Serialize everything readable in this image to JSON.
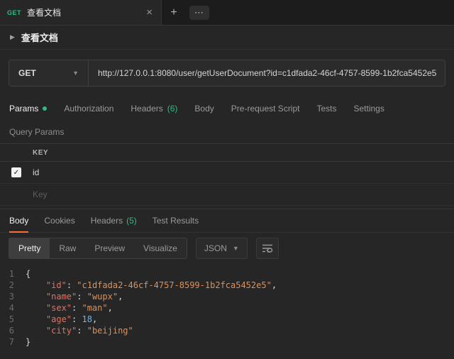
{
  "icons": {
    "close": "×",
    "plus": "+",
    "more": "⋯",
    "chevron_right": "▶",
    "chevron_down": "▼",
    "check": "✓"
  },
  "tab_bar": {
    "tab": {
      "method": "GET",
      "title": "查看文档"
    }
  },
  "request_header": {
    "title": "查看文档"
  },
  "url_bar": {
    "method": "GET",
    "url": "http://127.0.0.1:8080/user/getUserDocument?id=c1dfada2-46cf-4757-8599-1b2fca5452e5"
  },
  "request_tabs": [
    {
      "label": "Params"
    },
    {
      "label": "Authorization"
    },
    {
      "label": "Headers",
      "count": "(6)"
    },
    {
      "label": "Body"
    },
    {
      "label": "Pre-request Script"
    },
    {
      "label": "Tests"
    },
    {
      "label": "Settings"
    }
  ],
  "query_params": {
    "section_label": "Query Params",
    "key_header": "KEY",
    "rows": [
      {
        "key": "id",
        "checked": true
      },
      {
        "key_placeholder": "Key"
      }
    ]
  },
  "response": {
    "tabs": [
      {
        "label": "Body"
      },
      {
        "label": "Cookies"
      },
      {
        "label": "Headers",
        "count": "(5)"
      },
      {
        "label": "Test Results"
      }
    ],
    "modes": [
      "Pretty",
      "Raw",
      "Preview",
      "Visualize"
    ],
    "language": "JSON",
    "code": {
      "lines": [
        {
          "num": "1",
          "tokens": [
            {
              "type": "punc",
              "text": "{"
            }
          ]
        },
        {
          "num": "2",
          "tokens": [
            {
              "type": "punc",
              "text": "    "
            },
            {
              "type": "key",
              "text": "\"id\""
            },
            {
              "type": "punc",
              "text": ": "
            },
            {
              "type": "string",
              "text": "\"c1dfada2-46cf-4757-8599-1b2fca5452e5\""
            },
            {
              "type": "punc",
              "text": ","
            }
          ]
        },
        {
          "num": "3",
          "tokens": [
            {
              "type": "punc",
              "text": "    "
            },
            {
              "type": "key",
              "text": "\"name\""
            },
            {
              "type": "punc",
              "text": ": "
            },
            {
              "type": "string",
              "text": "\"wupx\""
            },
            {
              "type": "punc",
              "text": ","
            }
          ]
        },
        {
          "num": "4",
          "tokens": [
            {
              "type": "punc",
              "text": "    "
            },
            {
              "type": "key",
              "text": "\"sex\""
            },
            {
              "type": "punc",
              "text": ": "
            },
            {
              "type": "string",
              "text": "\"man\""
            },
            {
              "type": "punc",
              "text": ","
            }
          ]
        },
        {
          "num": "5",
          "tokens": [
            {
              "type": "punc",
              "text": "    "
            },
            {
              "type": "key",
              "text": "\"age\""
            },
            {
              "type": "punc",
              "text": ": "
            },
            {
              "type": "number",
              "text": "18"
            },
            {
              "type": "punc",
              "text": ","
            }
          ]
        },
        {
          "num": "6",
          "tokens": [
            {
              "type": "punc",
              "text": "    "
            },
            {
              "type": "key",
              "text": "\"city\""
            },
            {
              "type": "punc",
              "text": ": "
            },
            {
              "type": "string",
              "text": "\"beijing\""
            }
          ]
        },
        {
          "num": "7",
          "tokens": [
            {
              "type": "punc",
              "text": "}"
            }
          ]
        }
      ]
    }
  }
}
